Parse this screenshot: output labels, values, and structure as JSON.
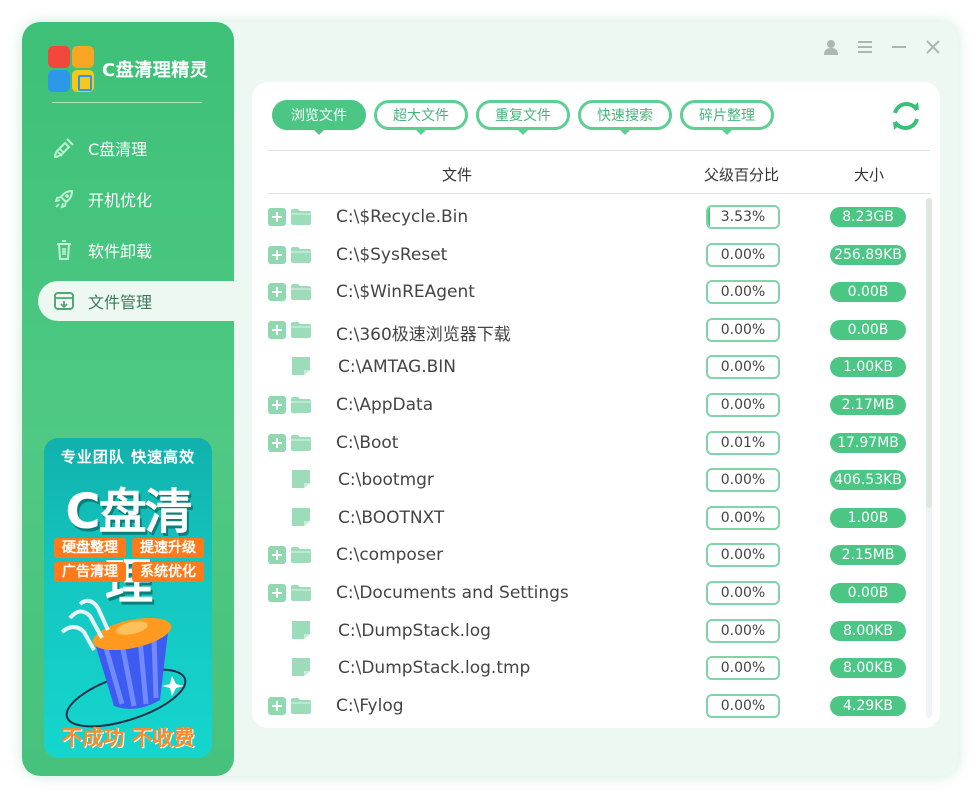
{
  "app": {
    "title": "C盘清理精灵"
  },
  "nav": {
    "items": [
      {
        "label": "C盘清理",
        "icon": "broom-icon",
        "active": false
      },
      {
        "label": "开机优化",
        "icon": "rocket-icon",
        "active": false
      },
      {
        "label": "软件卸载",
        "icon": "trash-icon",
        "active": false
      },
      {
        "label": "文件管理",
        "icon": "file-manager-icon",
        "active": true
      }
    ]
  },
  "promo": {
    "top": "专业团队  快速高效",
    "big": "C盘清理",
    "tags": [
      "硬盘整理",
      "提速升级",
      "广告清理",
      "系统优化"
    ],
    "bottom": "不成功 不收费"
  },
  "tabs": [
    {
      "label": "浏览文件",
      "active": true
    },
    {
      "label": "超大文件",
      "active": false
    },
    {
      "label": "重复文件",
      "active": false
    },
    {
      "label": "快速搜索",
      "active": false
    },
    {
      "label": "碎片整理",
      "active": false
    }
  ],
  "table": {
    "headers": {
      "file": "文件",
      "percent": "父级百分比",
      "size": "大小"
    },
    "rows": [
      {
        "type": "folder",
        "name": "C:\\$Recycle.Bin",
        "percent": "3.53%",
        "pct_value": 3.53,
        "size": "8.23GB"
      },
      {
        "type": "folder",
        "name": "C:\\$SysReset",
        "percent": "0.00%",
        "pct_value": 0,
        "size": "256.89KB"
      },
      {
        "type": "folder",
        "name": "C:\\$WinREAgent",
        "percent": "0.00%",
        "pct_value": 0,
        "size": "0.00B"
      },
      {
        "type": "folder",
        "name": "C:\\360极速浏览器下载",
        "percent": "0.00%",
        "pct_value": 0,
        "size": "0.00B"
      },
      {
        "type": "file",
        "name": "C:\\AMTAG.BIN",
        "percent": "0.00%",
        "pct_value": 0,
        "size": "1.00KB"
      },
      {
        "type": "folder",
        "name": "C:\\AppData",
        "percent": "0.00%",
        "pct_value": 0,
        "size": "2.17MB"
      },
      {
        "type": "folder",
        "name": "C:\\Boot",
        "percent": "0.01%",
        "pct_value": 0.01,
        "size": "17.97MB"
      },
      {
        "type": "file",
        "name": "C:\\bootmgr",
        "percent": "0.00%",
        "pct_value": 0,
        "size": "406.53KB"
      },
      {
        "type": "file",
        "name": "C:\\BOOTNXT",
        "percent": "0.00%",
        "pct_value": 0,
        "size": "1.00B"
      },
      {
        "type": "folder",
        "name": "C:\\composer",
        "percent": "0.00%",
        "pct_value": 0,
        "size": "2.15MB"
      },
      {
        "type": "folder",
        "name": "C:\\Documents and Settings",
        "percent": "0.00%",
        "pct_value": 0,
        "size": "0.00B"
      },
      {
        "type": "file",
        "name": "C:\\DumpStack.log",
        "percent": "0.00%",
        "pct_value": 0,
        "size": "8.00KB"
      },
      {
        "type": "file",
        "name": "C:\\DumpStack.log.tmp",
        "percent": "0.00%",
        "pct_value": 0,
        "size": "8.00KB"
      },
      {
        "type": "folder",
        "name": "C:\\Fylog",
        "percent": "0.00%",
        "pct_value": 0,
        "size": "4.29KB"
      }
    ]
  },
  "colors": {
    "accent": "#4cc685",
    "light_accent": "#7fd4a8",
    "sidebar": "#46c27d"
  }
}
